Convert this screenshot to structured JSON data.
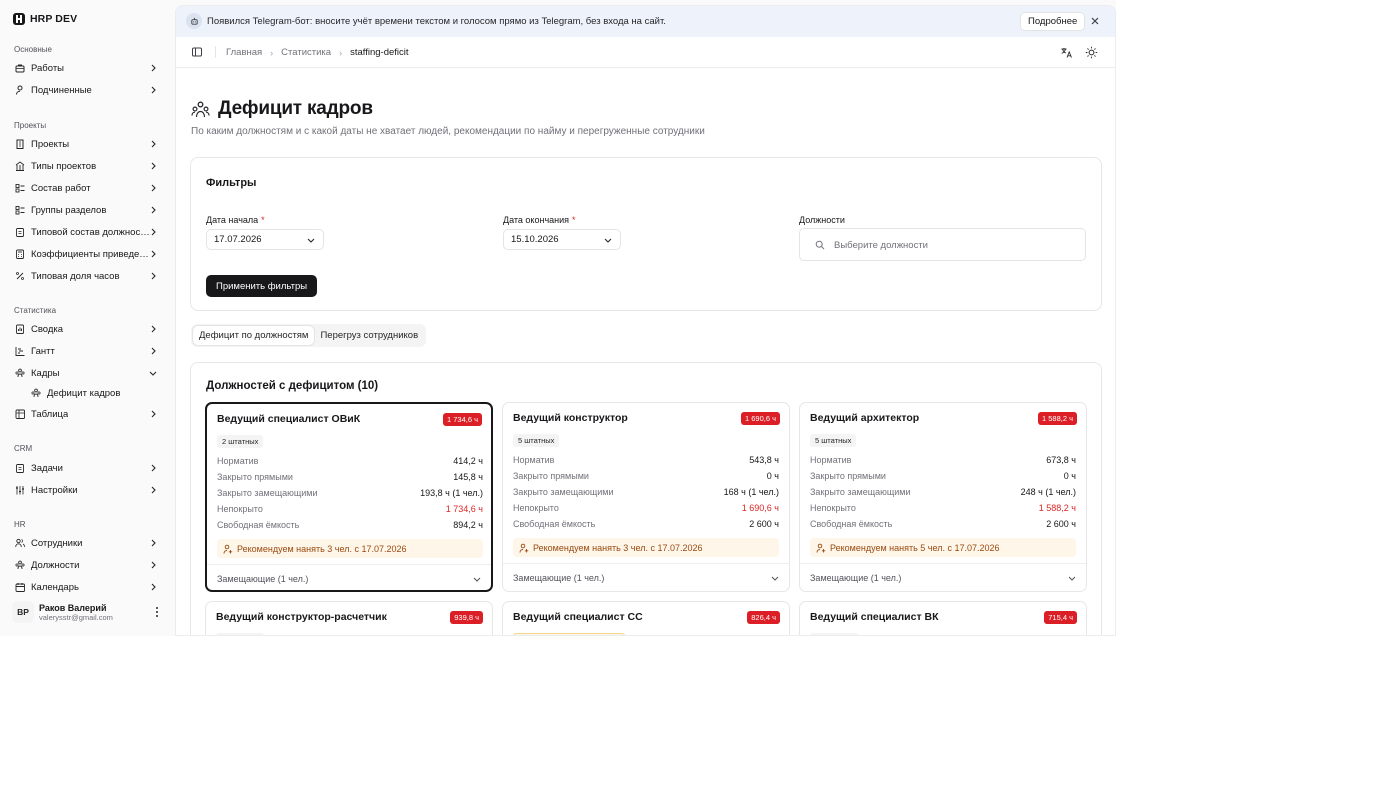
{
  "brand": {
    "name": "HRP DEV"
  },
  "sidebar": {
    "groups": [
      {
        "label": "Основные",
        "items": [
          {
            "label": "Работы",
            "icon": "briefcase-icon"
          },
          {
            "label": "Подчиненные",
            "icon": "user-icon"
          }
        ]
      },
      {
        "label": "Проекты",
        "items": [
          {
            "label": "Проекты",
            "icon": "building-icon"
          },
          {
            "label": "Типы проектов",
            "icon": "building-columns-icon"
          },
          {
            "label": "Состав работ",
            "icon": "list-icon"
          },
          {
            "label": "Группы разделов",
            "icon": "list-icon"
          },
          {
            "label": "Типовой состав должност…",
            "icon": "clipboard-icon"
          },
          {
            "label": "Коэффициенты приведени…",
            "icon": "calculator-icon"
          },
          {
            "label": "Типовая доля часов",
            "icon": "percent-icon"
          }
        ]
      },
      {
        "label": "Статистика",
        "items": [
          {
            "label": "Сводка",
            "icon": "summary-icon"
          },
          {
            "label": "Гантт",
            "icon": "gantt-icon"
          },
          {
            "label": "Кадры",
            "icon": "people-icon"
          },
          {
            "label": "Дефицит кадров",
            "icon": "people-icon"
          },
          {
            "label": "Таблица",
            "icon": "table-icon"
          }
        ]
      },
      {
        "label": "CRM",
        "items": [
          {
            "label": "Задачи",
            "icon": "clipboard-icon"
          },
          {
            "label": "Настройки",
            "icon": "sliders-icon"
          }
        ]
      },
      {
        "label": "HR",
        "items": [
          {
            "label": "Сотрудники",
            "icon": "users-icon"
          },
          {
            "label": "Должности",
            "icon": "people-icon"
          },
          {
            "label": "Календарь",
            "icon": "calendar-icon"
          }
        ]
      }
    ],
    "user": {
      "initials": "ВР",
      "name": "Раков Валерий",
      "email": "valerysstr@gmail.com"
    }
  },
  "banner": {
    "text": "Появился Telegram-бот: вносите учёт времени текстом и голосом прямо из Telegram, без входа на сайт.",
    "button": "Подробнее"
  },
  "breadcrumbs": [
    "Главная",
    "Статистика",
    "staffing-deficit"
  ],
  "page": {
    "title": "Дефицит кадров",
    "subtitle": "По каким должностям и с какой даты не хватает людей, рекомендации по найму и перегруженные сотрудники"
  },
  "filters": {
    "title": "Фильтры",
    "start_label": "Дата начала",
    "start_value": "17.07.2026",
    "end_label": "Дата окончания",
    "end_value": "15.10.2026",
    "positions_label": "Должности",
    "positions_placeholder": "Выберите должности",
    "required_mark": "*",
    "apply": "Применить фильтры"
  },
  "tabs": [
    "Дефицит по должностям",
    "Перегруз сотрудников"
  ],
  "deficit": {
    "title": "Должностей с дефицитом (10)",
    "row_labels": {
      "norm": "Норматив",
      "direct": "Закрыто прямыми",
      "subs": "Закрыто замещающими",
      "uncovered": "Непокрыто",
      "free": "Свободная ёмкость"
    },
    "cards": [
      {
        "title": "Ведущий специалист ОВиК",
        "badge": "1 734,6 ч",
        "staff": "2 штатных",
        "norm": "414,2 ч",
        "direct": "145,8 ч",
        "subs": "193,8 ч (1 чел.)",
        "uncovered": "1 734,6 ч",
        "free": "894,2 ч",
        "recommend": "Рекомендуем нанять 3 чел. с 17.07.2026",
        "substitutes": "Замещающие (1 чел.)"
      },
      {
        "title": "Ведущий конструктор",
        "badge": "1 690,6 ч",
        "staff": "5 штатных",
        "norm": "543,8 ч",
        "direct": "0 ч",
        "subs": "168 ч (1 чел.)",
        "uncovered": "1 690,6 ч",
        "free": "2 600 ч",
        "recommend": "Рекомендуем нанять 3 чел. с 17.07.2026",
        "substitutes": "Замещающие (1 чел.)"
      },
      {
        "title": "Ведущий архитектор",
        "badge": "1 588,2 ч",
        "staff": "5 штатных",
        "norm": "673,8 ч",
        "direct": "0 ч",
        "subs": "248 ч (1 чел.)",
        "uncovered": "1 588,2 ч",
        "free": "2 600 ч",
        "recommend": "Рекомендуем нанять 5 чел. с 17.07.2026",
        "substitutes": "Замещающие (1 чел.)"
      }
    ],
    "cards_next": [
      {
        "title": "Ведущий конструктор-расчетчик",
        "badge": "939,8 ч"
      },
      {
        "title": "Ведущий специалист СС",
        "badge": "826,4 ч"
      },
      {
        "title": "Ведущий специалист ВК",
        "badge": "715,4 ч"
      }
    ]
  },
  "colors": {
    "accent": "#18181b",
    "deficit_badge": "#dc1f26",
    "uncovered_text": "#dc2626",
    "recommend_bg": "#fdf6e9",
    "banner_bg": "#eef2fb"
  }
}
